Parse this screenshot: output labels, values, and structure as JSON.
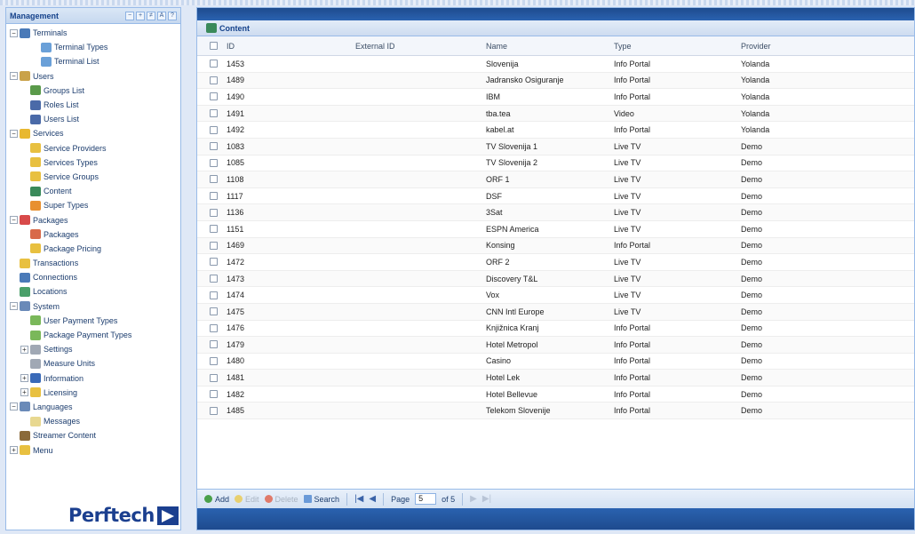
{
  "sidebar": {
    "title": "Management",
    "tools": [
      "−",
      "+",
      "≠",
      "A",
      "?"
    ],
    "tree": [
      {
        "label": "Terminals",
        "depth": 0,
        "expander": "−",
        "color": "#4a7ab8"
      },
      {
        "label": "Terminal Types",
        "depth": 2,
        "color": "#6aa0d8"
      },
      {
        "label": "Terminal List",
        "depth": 2,
        "color": "#6aa0d8"
      },
      {
        "label": "Users",
        "depth": 0,
        "expander": "−",
        "color": "#c9a24a"
      },
      {
        "label": "Groups List",
        "depth": 1,
        "color": "#5a9a4a"
      },
      {
        "label": "Roles List",
        "depth": 1,
        "color": "#4a6aa8"
      },
      {
        "label": "Users List",
        "depth": 1,
        "color": "#4a6aa8"
      },
      {
        "label": "Services",
        "depth": 0,
        "expander": "−",
        "color": "#e8b830"
      },
      {
        "label": "Service Providers",
        "depth": 1,
        "color": "#e8c040"
      },
      {
        "label": "Services Types",
        "depth": 1,
        "color": "#e8c040"
      },
      {
        "label": "Service Groups",
        "depth": 1,
        "color": "#e8c040"
      },
      {
        "label": "Content",
        "depth": 1,
        "color": "#3a8a5a"
      },
      {
        "label": "Super Types",
        "depth": 1,
        "color": "#e89030"
      },
      {
        "label": "Packages",
        "depth": 0,
        "expander": "−",
        "color": "#d84a4a"
      },
      {
        "label": "Packages",
        "depth": 1,
        "color": "#d86a4a"
      },
      {
        "label": "Package Pricing",
        "depth": 1,
        "color": "#e8c040"
      },
      {
        "label": "Transactions",
        "depth": 0,
        "color": "#e8c040"
      },
      {
        "label": "Connections",
        "depth": 0,
        "color": "#4a7ab8"
      },
      {
        "label": "Locations",
        "depth": 0,
        "color": "#4aa06a"
      },
      {
        "label": "System",
        "depth": 0,
        "expander": "−",
        "color": "#6a8ab8"
      },
      {
        "label": "User Payment Types",
        "depth": 1,
        "color": "#7ab85a"
      },
      {
        "label": "Package Payment Types",
        "depth": 1,
        "color": "#7ab85a"
      },
      {
        "label": "Settings",
        "depth": 1,
        "expander": "+",
        "color": "#a0a8b4"
      },
      {
        "label": "Measure Units",
        "depth": 1,
        "color": "#a0a8b4"
      },
      {
        "label": "Information",
        "depth": 1,
        "expander": "+",
        "color": "#3a6ab8"
      },
      {
        "label": "Licensing",
        "depth": 1,
        "expander": "+",
        "color": "#e8c040"
      },
      {
        "label": "Languages",
        "depth": 0,
        "expander": "−",
        "color": "#6a8ab8"
      },
      {
        "label": "Messages",
        "depth": 1,
        "color": "#e8d890"
      },
      {
        "label": "Streamer Content",
        "depth": 0,
        "color": "#8a6a3a"
      },
      {
        "label": "Menu",
        "depth": 0,
        "expander": "+",
        "color": "#e8c040"
      }
    ],
    "logo_text": "Perftech"
  },
  "panel": {
    "title": "Content",
    "columns": [
      "ID",
      "External ID",
      "Name",
      "Type",
      "Provider"
    ],
    "rows": [
      {
        "id": "1453",
        "external_id": "",
        "name": "Slovenija",
        "type": "Info Portal",
        "provider": "Yolanda"
      },
      {
        "id": "1489",
        "external_id": "",
        "name": "Jadransko Osiguranje",
        "type": "Info Portal",
        "provider": "Yolanda"
      },
      {
        "id": "1490",
        "external_id": "",
        "name": "IBM",
        "type": "Info Portal",
        "provider": "Yolanda"
      },
      {
        "id": "1491",
        "external_id": "",
        "name": "tba.tea",
        "type": "Video",
        "provider": "Yolanda"
      },
      {
        "id": "1492",
        "external_id": "",
        "name": "kabel.at",
        "type": "Info Portal",
        "provider": "Yolanda"
      },
      {
        "id": "1083",
        "external_id": "",
        "name": "TV Slovenija 1",
        "type": "Live TV",
        "provider": "Demo"
      },
      {
        "id": "1085",
        "external_id": "",
        "name": "TV Slovenija 2",
        "type": "Live TV",
        "provider": "Demo"
      },
      {
        "id": "1108",
        "external_id": "",
        "name": "ORF 1",
        "type": "Live TV",
        "provider": "Demo"
      },
      {
        "id": "1117",
        "external_id": "",
        "name": "DSF",
        "type": "Live TV",
        "provider": "Demo"
      },
      {
        "id": "1136",
        "external_id": "",
        "name": "3Sat",
        "type": "Live TV",
        "provider": "Demo"
      },
      {
        "id": "1151",
        "external_id": "",
        "name": "ESPN America",
        "type": "Live TV",
        "provider": "Demo"
      },
      {
        "id": "1469",
        "external_id": "",
        "name": "Konsing",
        "type": "Info Portal",
        "provider": "Demo"
      },
      {
        "id": "1472",
        "external_id": "",
        "name": "ORF 2",
        "type": "Live TV",
        "provider": "Demo"
      },
      {
        "id": "1473",
        "external_id": "",
        "name": "Discovery T&L",
        "type": "Live TV",
        "provider": "Demo"
      },
      {
        "id": "1474",
        "external_id": "",
        "name": "Vox",
        "type": "Live TV",
        "provider": "Demo"
      },
      {
        "id": "1475",
        "external_id": "",
        "name": "CNN Intl Europe",
        "type": "Live TV",
        "provider": "Demo"
      },
      {
        "id": "1476",
        "external_id": "",
        "name": "Knjižnica Kranj",
        "type": "Info Portal",
        "provider": "Demo"
      },
      {
        "id": "1479",
        "external_id": "",
        "name": "Hotel Metropol",
        "type": "Info Portal",
        "provider": "Demo"
      },
      {
        "id": "1480",
        "external_id": "",
        "name": "Casino",
        "type": "Info Portal",
        "provider": "Demo"
      },
      {
        "id": "1481",
        "external_id": "",
        "name": "Hotel Lek",
        "type": "Info Portal",
        "provider": "Demo"
      },
      {
        "id": "1482",
        "external_id": "",
        "name": "Hotel Bellevue",
        "type": "Info Portal",
        "provider": "Demo"
      },
      {
        "id": "1485",
        "external_id": "",
        "name": "Telekom Slovenije",
        "type": "Info Portal",
        "provider": "Demo"
      }
    ]
  },
  "pager": {
    "add_label": "Add",
    "edit_label": "Edit",
    "delete_label": "Delete",
    "search_label": "Search",
    "page_label": "Page",
    "page_value": "5",
    "of_label": "of 5"
  }
}
